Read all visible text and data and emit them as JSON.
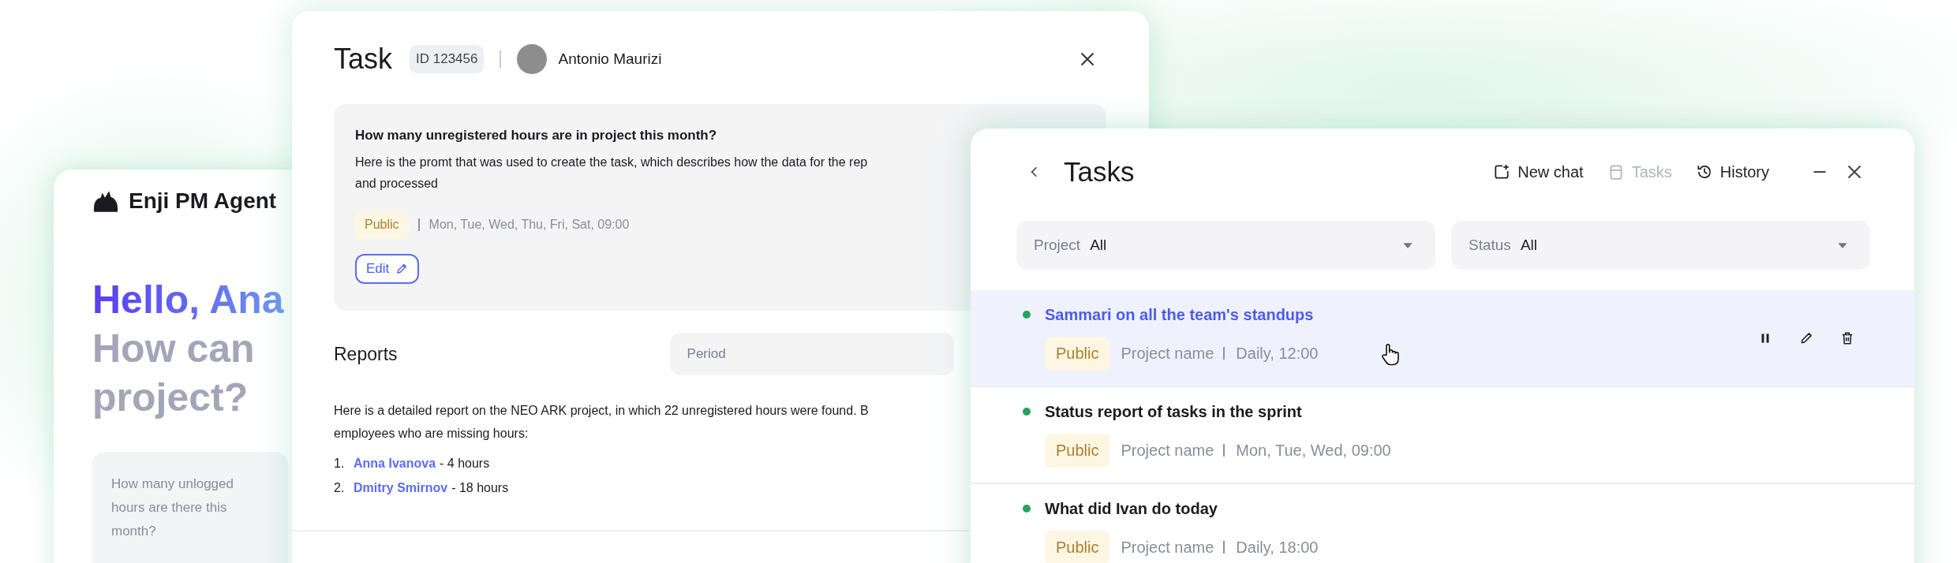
{
  "agent_panel": {
    "brand": "Enji PM Agent",
    "greeting": "Hello, Ana",
    "subtitle_lines": [
      "How can",
      "project?"
    ],
    "suggestion": "How many unlogged hours are there this month?"
  },
  "task_window": {
    "title": "Task",
    "id_badge": "ID 123456",
    "assignee": "Antonio Maurizi",
    "prompt": {
      "question": "How many unregistered hours are in project this month?",
      "description_lines": [
        "Here is the promt that was used to create the task, which describes how the data for the rep",
        "and processed"
      ],
      "tag": "Public",
      "schedule": "Mon, Tue, Wed, Thu, Fri, Sat, 09:00",
      "edit_button": "Edit"
    },
    "reports": {
      "title": "Reports",
      "period": {
        "placeholder": "Period"
      },
      "text_lines": [
        "Here is a detailed report on the NEO ARK project, in which 22 unregistered hours were found. B",
        "employees who are missing hours:"
      ],
      "items": [
        {
          "number": "1.",
          "name": "Anna Ivanova",
          "detail": "- 4 hours"
        },
        {
          "number": "2.",
          "name": "Dmitry Smirnov",
          "detail": "- 18 hours"
        }
      ]
    }
  },
  "tasks_window": {
    "title": "Tasks",
    "toolbar": [
      {
        "kind": "new-chat",
        "label": "New chat",
        "disabled": false
      },
      {
        "kind": "tasks",
        "label": "Tasks",
        "disabled": true
      },
      {
        "kind": "history",
        "label": "History",
        "disabled": false
      }
    ],
    "filters": [
      {
        "label": "Project",
        "value": "All"
      },
      {
        "label": "Status",
        "value": "All"
      }
    ],
    "rows": [
      {
        "title": "Sammari on all the team's standups",
        "tag": "Public",
        "project": "Project name",
        "schedule": "Daily, 12:00",
        "selected": true
      },
      {
        "title": "Status report of tasks in the sprint",
        "tag": "Public",
        "project": "Project name",
        "schedule": "Mon, Tue, Wed,  09:00",
        "selected": false
      },
      {
        "title": "What did Ivan do today",
        "tag": "Public",
        "project": "Project name",
        "schedule": "Daily, 18:00",
        "selected": false
      }
    ]
  }
}
